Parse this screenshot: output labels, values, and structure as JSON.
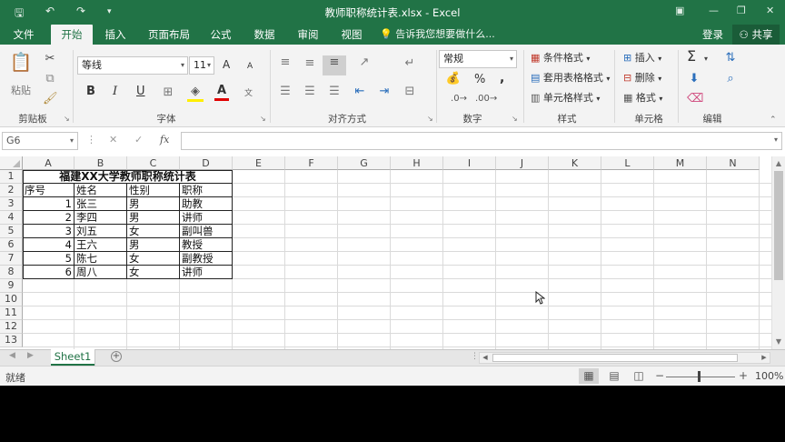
{
  "titlebar": {
    "title": "教师职称统计表.xlsx - Excel",
    "quick_access": [
      "save-icon",
      "undo-icon",
      "redo-icon",
      "customize-icon"
    ],
    "window_controls": [
      "ribbon-display-icon",
      "minimize-icon",
      "restore-icon",
      "close-icon"
    ]
  },
  "tabs": [
    "文件",
    "开始",
    "插入",
    "页面布局",
    "公式",
    "数据",
    "审阅",
    "视图"
  ],
  "active_tab": "开始",
  "tell_me": "告诉我您想要做什么...",
  "signin": "登录",
  "share": "共享",
  "ribbon": {
    "clipboard": {
      "paste": "粘贴",
      "label": "剪贴板"
    },
    "font": {
      "name": "等线",
      "size": "11",
      "label": "字体",
      "bold": "B",
      "italic": "I",
      "underline": "U",
      "increase": "A",
      "decrease": "A",
      "phonetic": "文"
    },
    "alignment": {
      "label": "对齐方式"
    },
    "number": {
      "format": "常规",
      "label": "数字",
      "percent": "%",
      "comma": ","
    },
    "styles": {
      "conditional": "条件格式",
      "table": "套用表格格式",
      "cell": "单元格样式",
      "label": "样式"
    },
    "cells": {
      "insert": "插入",
      "delete": "删除",
      "format": "格式",
      "label": "单元格"
    },
    "editing": {
      "label": "编辑",
      "autosum": "Σ"
    }
  },
  "formula_bar": {
    "name_box": "G6",
    "fx": "fx",
    "formula": ""
  },
  "columns": [
    "A",
    "B",
    "C",
    "D",
    "E",
    "F",
    "G",
    "H",
    "I",
    "J",
    "K",
    "L",
    "M",
    "N"
  ],
  "rows": [
    "1",
    "2",
    "3",
    "4",
    "5",
    "6",
    "7",
    "8",
    "9",
    "10",
    "11",
    "12",
    "13"
  ],
  "sheet": {
    "title": "福建XX大学教师职称统计表",
    "headers": [
      "序号",
      "姓名",
      "性别",
      "职称"
    ],
    "records": [
      [
        "1",
        "张三",
        "男",
        "助教"
      ],
      [
        "2",
        "李四",
        "男",
        "讲师"
      ],
      [
        "3",
        "刘五",
        "女",
        "副叫兽"
      ],
      [
        "4",
        "王六",
        "男",
        "教授"
      ],
      [
        "5",
        "陈七",
        "女",
        "副教授"
      ],
      [
        "6",
        "周八",
        "女",
        "讲师"
      ]
    ]
  },
  "sheet_tabs": [
    "Sheet1"
  ],
  "status": {
    "text": "就绪",
    "zoom": "100%"
  },
  "colors": {
    "accent": "#217346",
    "share_bg": "#1a5c38",
    "ribbon_bg": "#f3f3f3"
  }
}
